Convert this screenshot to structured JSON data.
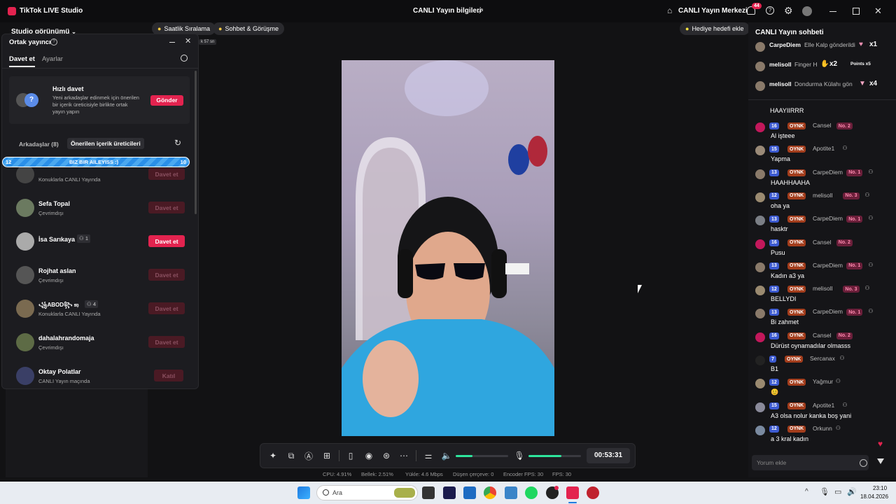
{
  "window": {
    "app_title": "TikTok LIVE Studio",
    "center_title": "CANLI Yayın bilgileri",
    "live_center": "CANLI Yayın Merkezi",
    "notif_count": "44"
  },
  "toolbar": {
    "studio_view": "Studio görünümü",
    "pill_hourly": "Saatlik Sıralama",
    "pill_chat": "Sohbet & Görüşme",
    "gift_goal": "Hediye hedefi ekle",
    "timer_fragment": "k 57 sn"
  },
  "cohost": {
    "title": "Ortak yayıncı",
    "tab_invite": "Davet et",
    "tab_settings": "Ayarlar",
    "quick_title": "Hızlı davet",
    "quick_desc": "Yeni arkadaşlar edinmek için önerilen bir içerik üreticisiyle birlikte ortak yayın yapın",
    "send_label": "Gönder",
    "friends_tab": "Arkadaşlar (8)",
    "suggested_tab": "Önerilen içerik üreticileri",
    "banner_left": "12",
    "banner_text": "BIZ BIR AILEYISS :)",
    "banner_right": "10",
    "rows": [
      {
        "name": "",
        "sub": "Konuklarla CANLI Yayında",
        "btn": "Davet et",
        "active": false
      },
      {
        "name": "Sefa Topal",
        "sub": "Çevrimdışı",
        "btn": "Davet et",
        "active": false
      },
      {
        "name": "İsa Sarıkaya",
        "count": "1",
        "sub": "",
        "btn": "Davet et",
        "active": true
      },
      {
        "name": "Rojhat aslan",
        "sub": "Çevrimdışı",
        "btn": "Davet et",
        "active": false
      },
      {
        "name": "꧁ABOD꧂ 𝔰𝔶",
        "count": "4",
        "sub": "Konuklarla CANLI Yayında",
        "btn": "Davet et",
        "active": false
      },
      {
        "name": "dahalahrandomaja",
        "sub": "Çevrimdışı",
        "btn": "Davet et",
        "active": false
      },
      {
        "name": "Oktay Polatlar",
        "sub": "CANLI Yayın maçında",
        "btn": "Katıl",
        "active": false
      }
    ]
  },
  "chat": {
    "title": "CANLI Yayın sohbeti",
    "gifts": [
      {
        "user": "CarpeDiem",
        "text": "Elle Kalp gönderildi",
        "mult": "x1"
      },
      {
        "user": "melisoll",
        "text": "Finger H",
        "mult": "x2",
        "extra": "Points x5"
      },
      {
        "user": "melisoll",
        "text": "Dondurma Külahı gön",
        "mult": "x4"
      }
    ],
    "first_line": "HAAYIIRRR",
    "messages": [
      {
        "lvl": "16",
        "oy": "OYNK",
        "user": "Cansel",
        "no": "No. 2",
        "text": "Al işteee"
      },
      {
        "lvl": "15",
        "oy": "OYNK",
        "user": "Apotite1",
        "no": "",
        "text": "Yapma"
      },
      {
        "lvl": "13",
        "oy": "OYNK",
        "user": "CarpeDiem",
        "no": "No. 1",
        "text": "HAAHHAAHA"
      },
      {
        "lvl": "12",
        "oy": "OYNK",
        "user": "melisoll",
        "no": "No. 3",
        "text": "oha ya"
      },
      {
        "lvl": "13",
        "oy": "OYNK",
        "user": "CarpeDiem",
        "no": "No. 1",
        "text": "hasktr"
      },
      {
        "lvl": "16",
        "oy": "OYNK",
        "user": "Cansel",
        "no": "No. 2",
        "text": "Pusu"
      },
      {
        "lvl": "13",
        "oy": "OYNK",
        "user": "CarpeDiem",
        "no": "No. 1",
        "text": "Kadın a3 ya"
      },
      {
        "lvl": "12",
        "oy": "OYNK",
        "user": "melisoll",
        "no": "No. 3",
        "text": "BELLYDI"
      },
      {
        "lvl": "13",
        "oy": "OYNK",
        "user": "CarpeDiem",
        "no": "No. 1",
        "text": "Bi zahmet"
      },
      {
        "lvl": "16",
        "oy": "OYNK",
        "user": "Cansel",
        "no": "No. 2",
        "text": "Dürüst oynamadılar olmasss"
      },
      {
        "lvl": "7",
        "oy": "OYNK",
        "user": "Sercanax",
        "no": "",
        "text": "B1"
      },
      {
        "lvl": "12",
        "oy": "OYNK",
        "user": "Yağmur",
        "no": "",
        "text": "😊"
      },
      {
        "lvl": "15",
        "oy": "OYNK",
        "user": "Apotite1",
        "no": "",
        "text": "A3 olsa nolur kanka boş yani"
      },
      {
        "lvl": "12",
        "oy": "OYNK",
        "user": "Orkunn",
        "no": "",
        "text": "a 3 kral kadın"
      }
    ],
    "comment_placeholder": "Yorum ekle"
  },
  "controls": {
    "timer": "00:53:31",
    "speaker_level": 0.32,
    "mic_level": 0.62
  },
  "stats": {
    "cpu": "CPU: 4.91%",
    "mem": "Bellek: 2.51%",
    "upload": "Yükle: 4.6 Mbps",
    "dropped": "Düşen çerçeve: 0",
    "enc_fps": "Encoder FPS: 30",
    "fps": "FPS: 30"
  },
  "taskbar": {
    "search_placeholder": "Ara",
    "time": "23:10",
    "date": "18.04.2026"
  },
  "colors": {
    "accent": "#e3234f",
    "level_badge": "#3d5bd1",
    "timer_green": "#2ee59d"
  }
}
